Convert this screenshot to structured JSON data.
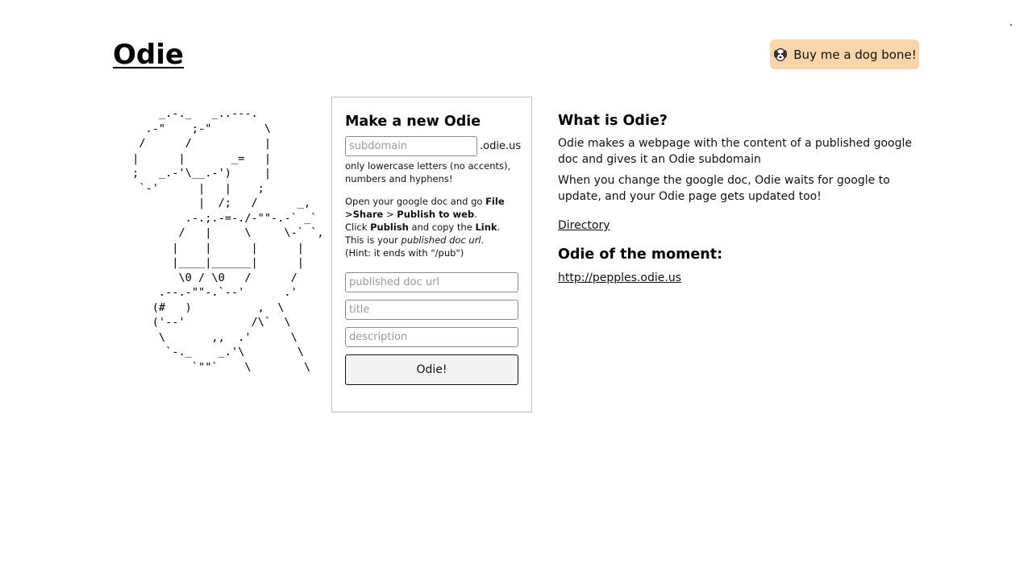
{
  "header": {
    "logo": "Odie",
    "bone_button_label": "Buy me a dog bone!",
    "bone_button_icon": "dog-icon",
    "bone_button_color": "#f9d5a7"
  },
  "ascii_art": "     _.-._   _..---.\n   .-\"    ;-\"        \\\n  /      /           |\n |      |       _=   |\n ;   _.-'\\__.-')     |\n  `-'      |   |    ;\n           |  /;   /      _,\n         .-.;.-=-./-\"\"-.-` _`\n        /   |     \\     \\-` `,\n       |    |      |      |\n       |____|______|      |\n        \\0 / \\0   /      /\n     .--.-\"\"-.`--'      .'\n    (#   )          ,  \\\n    ('--'          /\\`  \\\n     \\       ,,  .'      \\\n      `-._    _.'\\        \\\n          `\"\"`    \\        \\",
  "form": {
    "title": "Make a new Odie",
    "subdomain_placeholder": "subdomain",
    "subdomain_suffix": ".odie.us",
    "subdomain_hint": "only lowercase letters (no accents), numbers and hyphens!",
    "instructions": {
      "line1_prefix": "Open your google doc and go ",
      "file": "File",
      "sep1": " >",
      "share": "Share",
      "sep2": " > ",
      "publish_to_web": "Publish to web",
      "period1": ".",
      "click": "Click ",
      "publish": "Publish",
      "copy_the": " and copy the ",
      "link": "Link",
      "period2": ".",
      "this_is_your": "This is your ",
      "published_doc_url": "published doc url",
      "period3": ".",
      "hint": "(Hint: it ends with \"/pub\")"
    },
    "url_placeholder": "published doc url",
    "title_placeholder": "title",
    "description_placeholder": "description",
    "submit_label": "Odie!"
  },
  "about": {
    "heading": "What is Odie?",
    "paragraph1": "Odie makes a webpage with the content of a published google doc and gives it an Odie subdomain",
    "paragraph2": "When you change the google doc, Odie waits for google to update, and your Odie page gets updated too!",
    "directory_link": "Directory",
    "moment_heading": "Odie of the moment:",
    "moment_link": "http://pepples.odie.us"
  }
}
